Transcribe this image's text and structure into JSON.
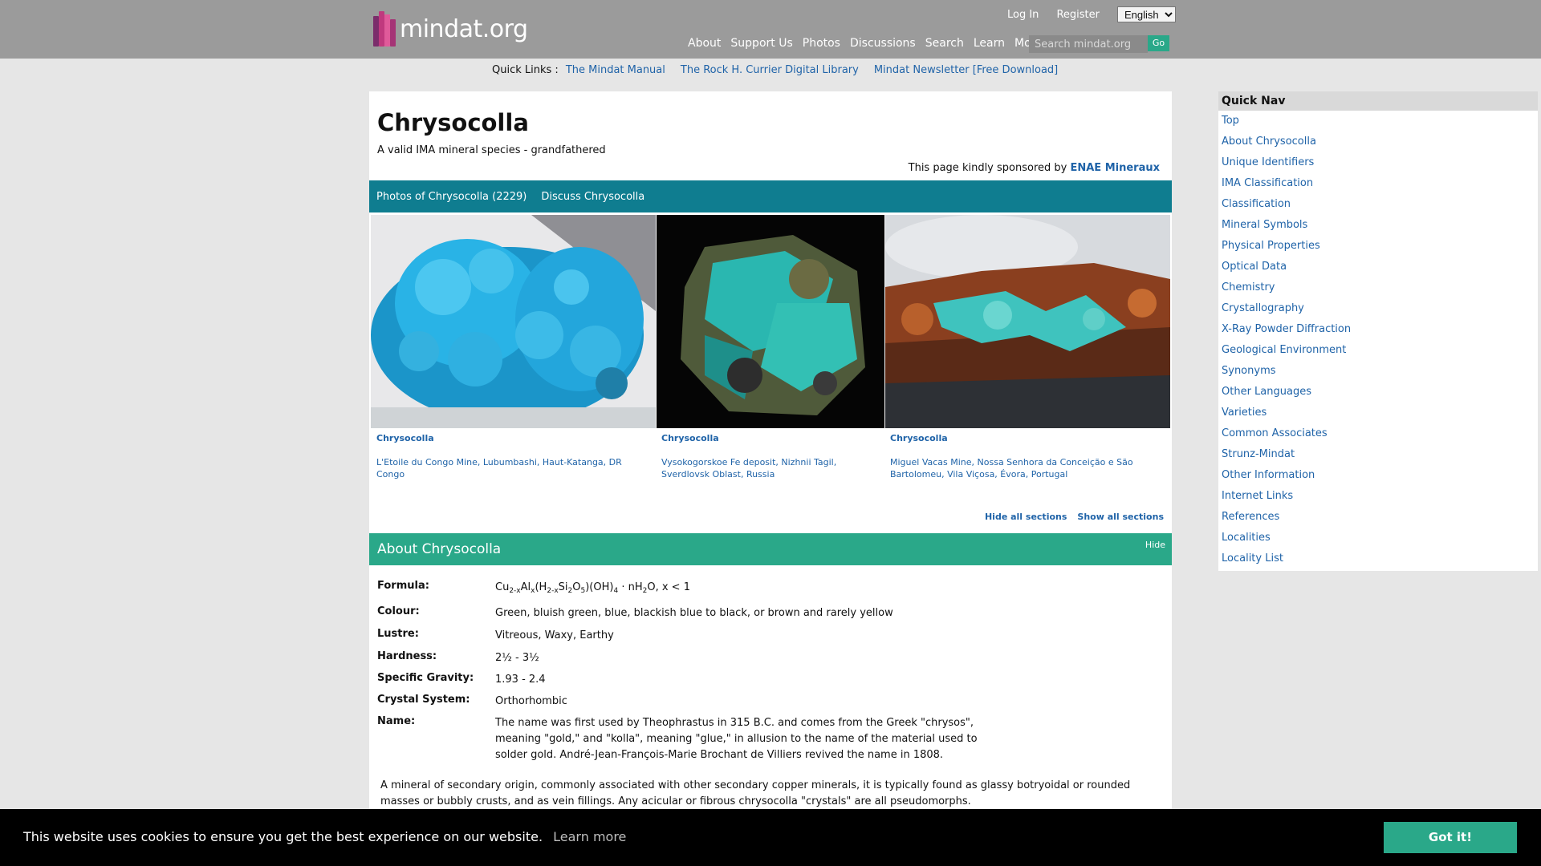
{
  "header": {
    "logo_text": "mindat.org",
    "top_links": [
      "Log In",
      "Register"
    ],
    "language": "English",
    "nav": [
      "About",
      "Support Us",
      "Photos",
      "Discussions",
      "Search",
      "Learn",
      "More"
    ],
    "search_placeholder": "Search mindat.org",
    "go_label": "Go"
  },
  "quick_links": {
    "label": "Quick Links :",
    "items": [
      "The Mindat Manual",
      "The Rock H. Currier Digital Library",
      "Mindat Newsletter [Free Download]"
    ]
  },
  "page": {
    "title": "Chrysocolla",
    "subtitle": "A valid IMA mineral species - grandfathered",
    "sponsor_text": "This page kindly sponsored by",
    "sponsor_name": "ENAE Mineraux"
  },
  "tabs": [
    "Photos of Chrysocolla (2229)",
    "Discuss Chrysocolla"
  ],
  "photos": [
    {
      "title": "Chrysocolla",
      "location": "L'Etoile du Congo Mine, Lubumbashi, Haut-Katanga, DR Congo"
    },
    {
      "title": "Chrysocolla",
      "location": "Vysokogorskoe Fe deposit, Nizhnii Tagil, Sverdlovsk Oblast, Russia"
    },
    {
      "title": "Chrysocolla",
      "location": "Miguel Vacas Mine, Nossa Senhora da Conceição e São Bartolomeu, Vila Viçosa, Évora, Portugal"
    }
  ],
  "section_controls": {
    "hide_all": "Hide all sections",
    "show_all": "Show all sections"
  },
  "about": {
    "title": "About Chrysocolla",
    "hide_label": "Hide",
    "formula_label": "Formula:",
    "formula_tail": "O, x < 1",
    "properties": [
      {
        "label": "Colour:",
        "value": "Green, bluish green, blue, blackish blue to black, or brown and rarely yellow"
      },
      {
        "label": "Lustre:",
        "value": "Vitreous, Waxy, Earthy"
      },
      {
        "label": "Hardness:",
        "value": "2½ - 3½"
      },
      {
        "label": "Specific Gravity:",
        "value": "1.93 - 2.4"
      },
      {
        "label": "Crystal System:",
        "value": "Orthorhombic"
      },
      {
        "label": "Name:",
        "value": "The name was first used by Theophrastus in 315 B.C. and comes from the Greek \"chrysos\", meaning \"gold,\" and \"kolla\", meaning \"glue,\" in allusion to the name of the material used to solder gold. André-Jean-François-Marie Brochant de Villiers revived the name in 1808."
      }
    ],
    "description": "A mineral of secondary origin, commonly associated with other secondary copper minerals, it is typically found as glassy botryoidal or rounded masses or bubbly crusts, and as vein fillings. Any acicular or fibrous chrysocolla \"crystals\" are all pseudomorphs."
  },
  "quick_nav": {
    "title": "Quick Nav",
    "items": [
      "Top",
      "About Chrysocolla",
      "Unique Identifiers",
      "IMA Classification",
      "Classification",
      "Mineral Symbols",
      "Physical Properties",
      "Optical Data",
      "Chemistry",
      "Crystallography",
      "X-Ray Powder Diffraction",
      "Geological Environment",
      "Synonyms",
      "Other Languages",
      "Varieties",
      "Common Associates",
      "Strunz-Mindat",
      "Other Information",
      "Internet Links",
      "References",
      "Localities",
      "Locality List"
    ]
  },
  "cookie": {
    "message": "This website uses cookies to ensure you get the best experience on our website.",
    "learn_more": "Learn more",
    "button": "Got it!"
  },
  "colors": {
    "header_bg": "#9b9b9b",
    "teal_tab": "#0f7d90",
    "green_accent": "#2aa889",
    "link": "#1f63a8"
  }
}
